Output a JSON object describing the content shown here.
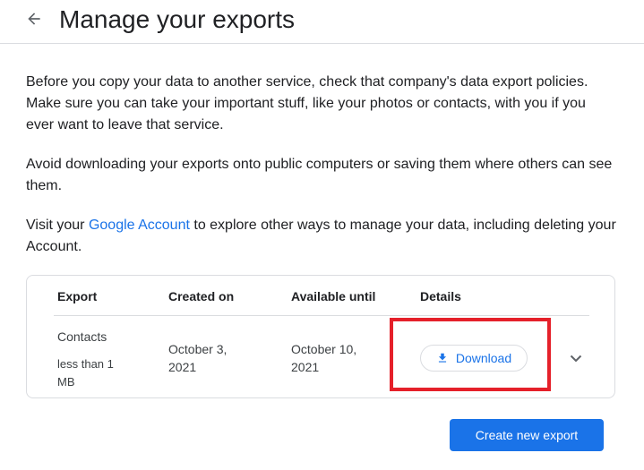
{
  "header": {
    "title": "Manage your exports",
    "back_icon": "arrow-back-icon"
  },
  "intro": {
    "paragraph1": "Before you copy your data to another service, check that company's data export policies. Make sure you can take your important stuff, like your photos or contacts, with you if you ever want to leave that service.",
    "paragraph2": "Avoid downloading your exports onto public computers or saving them where others can see them.",
    "paragraph3_before": "Visit your ",
    "paragraph3_link": "Google Account",
    "paragraph3_after": " to explore other ways to manage your data, including deleting your Account."
  },
  "table": {
    "headers": {
      "export": "Export",
      "created": "Created on",
      "available": "Available until",
      "details": "Details"
    },
    "rows": [
      {
        "name": "Contacts",
        "size": "less than 1 MB",
        "created": "October 3, 2021",
        "available": "October 10, 2021",
        "download_label": "Download"
      }
    ]
  },
  "actions": {
    "create_label": "Create new export"
  },
  "colors": {
    "accent": "#1a73e8",
    "highlight": "#e5202a",
    "divider": "#dadce0"
  }
}
